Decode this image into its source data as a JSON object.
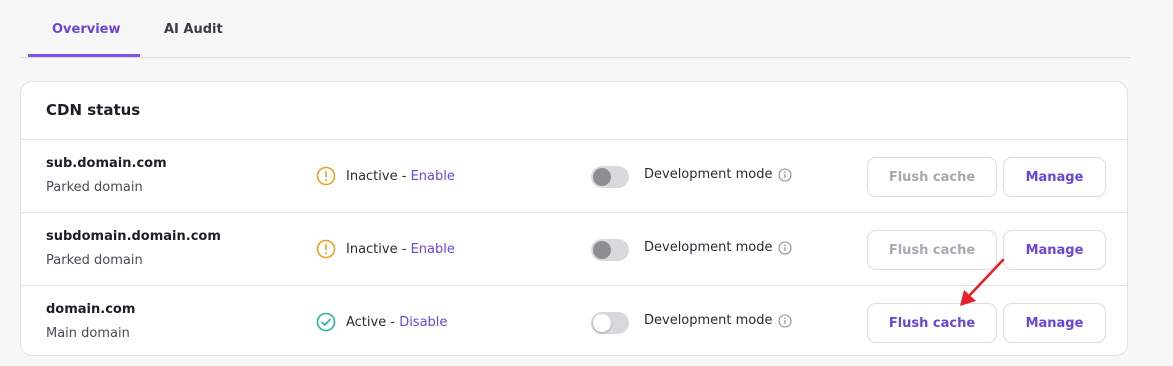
{
  "tabs": [
    {
      "label": "Overview",
      "active": true
    },
    {
      "label": "AI Audit",
      "active": false
    }
  ],
  "cdn": {
    "title": "CDN status",
    "rows": [
      {
        "domain": "sub.domain.com",
        "type": "Parked domain",
        "status_label": "Inactive",
        "status_separator": " - ",
        "status_action": "Enable",
        "status_icon": "warning-circle-icon",
        "dev_mode_label": "Development mode",
        "dev_mode_on": false,
        "flush_label": "Flush cache",
        "flush_enabled": false,
        "manage_label": "Manage"
      },
      {
        "domain": "subdomain.domain.com",
        "type": "Parked domain",
        "status_label": "Inactive",
        "status_separator": " - ",
        "status_action": "Enable",
        "status_icon": "warning-circle-icon",
        "dev_mode_label": "Development mode",
        "dev_mode_on": false,
        "flush_label": "Flush cache",
        "flush_enabled": false,
        "manage_label": "Manage"
      },
      {
        "domain": "domain.com",
        "type": "Main domain",
        "status_label": "Active",
        "status_separator": " - ",
        "status_action": "Disable",
        "status_icon": "check-circle-icon",
        "dev_mode_label": "Development mode",
        "dev_mode_on": false,
        "flush_label": "Flush cache",
        "flush_enabled": true,
        "manage_label": "Manage"
      }
    ]
  },
  "colors": {
    "accent": "#6a45d8",
    "warning": "#f0a020",
    "success": "#2bb5a0",
    "annotation_arrow": "#e8202a"
  }
}
